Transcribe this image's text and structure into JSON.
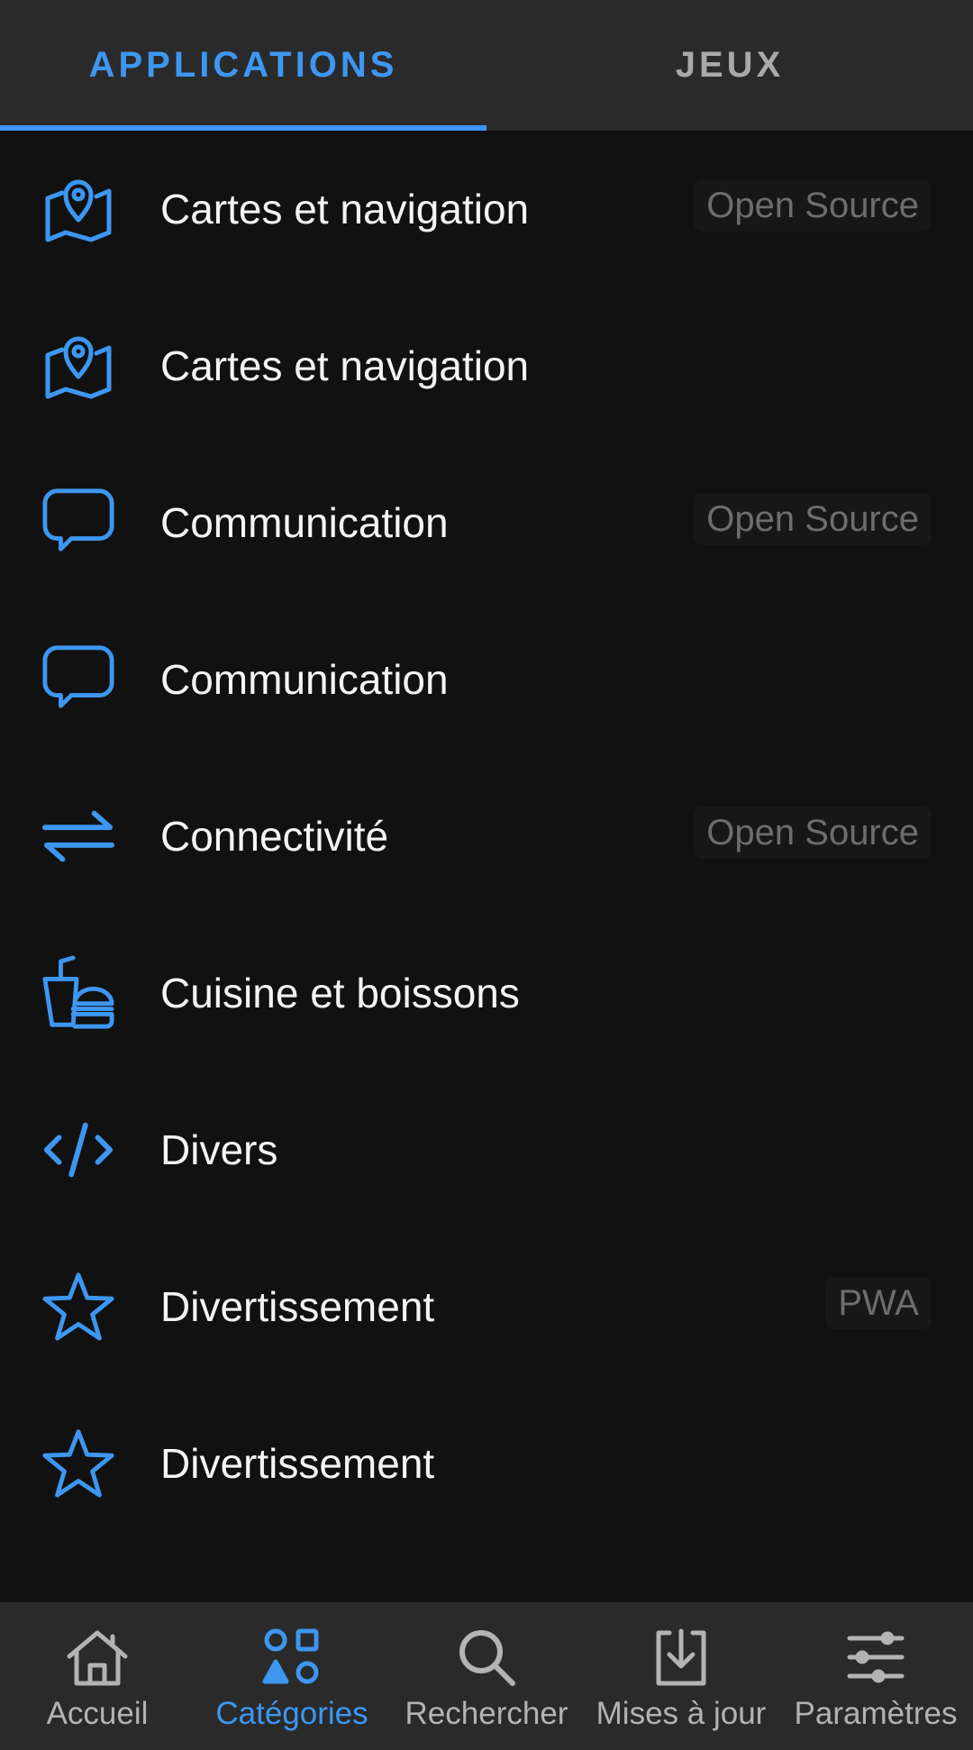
{
  "tabs": [
    {
      "label": "APPLICATIONS",
      "active": true
    },
    {
      "label": "JEUX",
      "active": false
    }
  ],
  "categories": [
    {
      "label": "Cartes et navigation",
      "icon": "map-pin-icon",
      "badge": "Open Source"
    },
    {
      "label": "Cartes et navigation",
      "icon": "map-pin-icon",
      "badge": ""
    },
    {
      "label": "Communication",
      "icon": "chat-bubble-icon",
      "badge": "Open Source"
    },
    {
      "label": "Communication",
      "icon": "chat-bubble-icon",
      "badge": ""
    },
    {
      "label": "Connectivité",
      "icon": "arrows-exchange-icon",
      "badge": "Open Source"
    },
    {
      "label": "Cuisine et boissons",
      "icon": "food-drink-icon",
      "badge": ""
    },
    {
      "label": "Divers",
      "icon": "code-icon",
      "badge": ""
    },
    {
      "label": "Divertissement",
      "icon": "star-icon",
      "badge": "PWA"
    },
    {
      "label": "Divertissement",
      "icon": "star-icon",
      "badge": ""
    }
  ],
  "bottom_nav": [
    {
      "label": "Accueil",
      "icon": "home-icon",
      "active": false
    },
    {
      "label": "Catégories",
      "icon": "categories-icon",
      "active": true
    },
    {
      "label": "Rechercher",
      "icon": "search-icon",
      "active": false
    },
    {
      "label": "Mises à jour",
      "icon": "download-icon",
      "active": false
    },
    {
      "label": "Paramètres",
      "icon": "sliders-icon",
      "active": false
    }
  ],
  "colors": {
    "accent": "#3d97f1",
    "background": "#111112",
    "bar_background": "#2a2a2b",
    "text": "#f4f4f4",
    "muted": "#a9a9ab"
  }
}
